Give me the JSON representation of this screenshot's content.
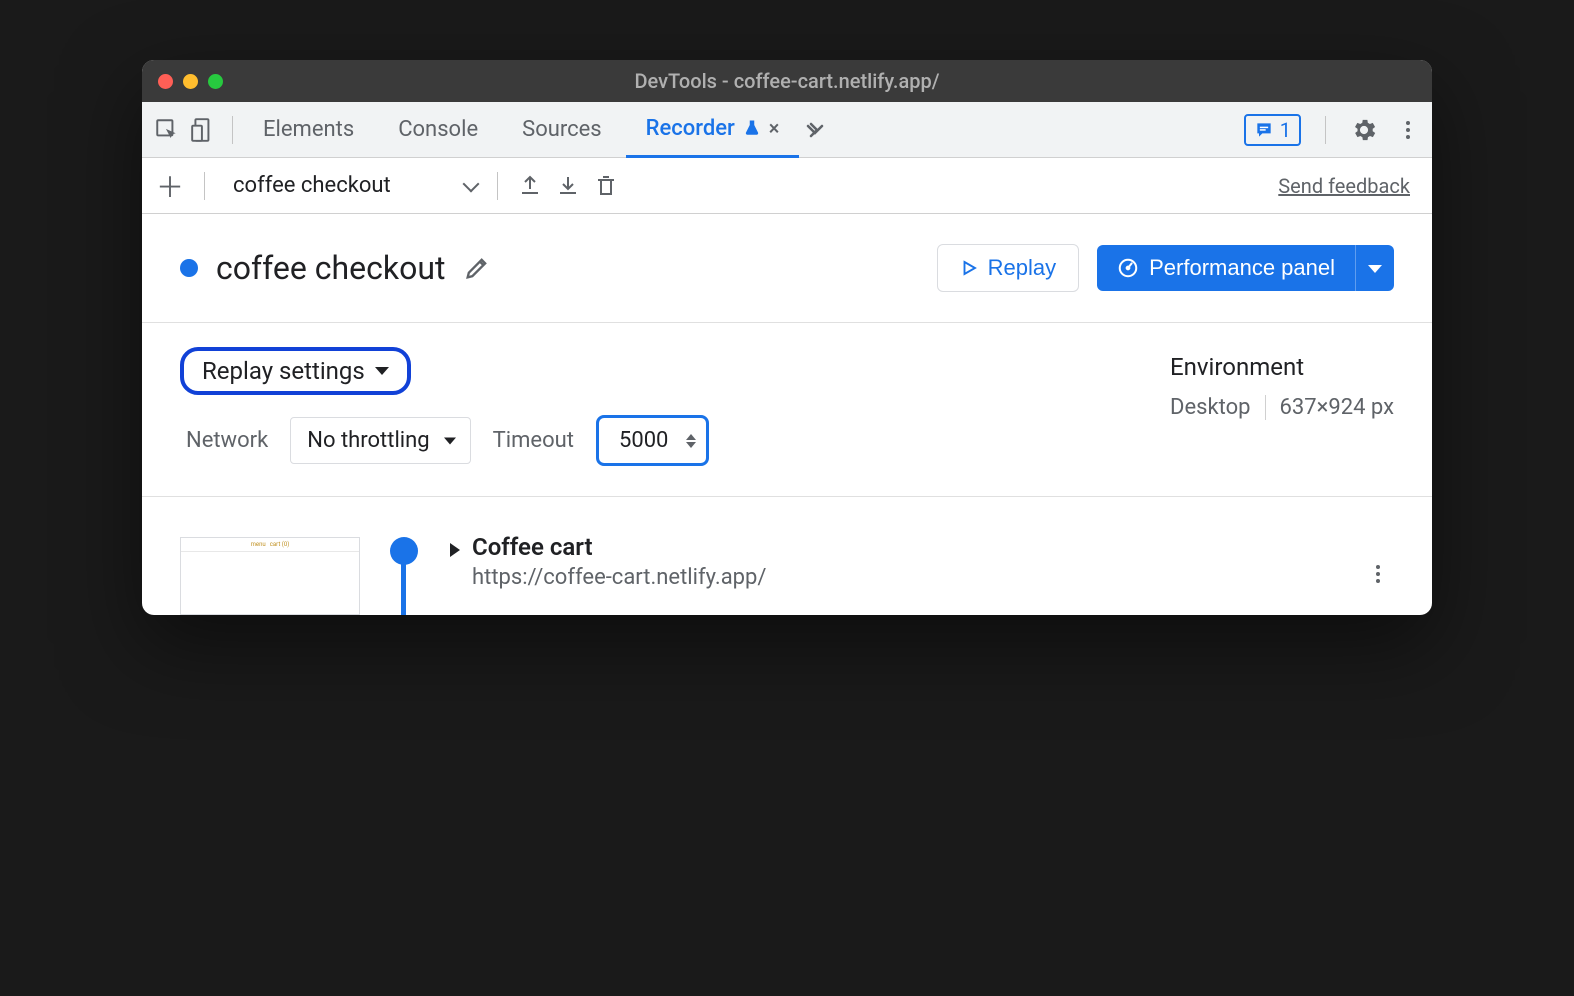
{
  "window": {
    "title": "DevTools - coffee-cart.netlify.app/"
  },
  "tabs": {
    "elements": "Elements",
    "console": "Console",
    "sources": "Sources",
    "recorder": "Recorder"
  },
  "issues_count": "1",
  "toolbar": {
    "recording_name": "coffee checkout",
    "send_feedback": "Send feedback"
  },
  "header": {
    "title": "coffee checkout",
    "replay_label": "Replay",
    "perf_label": "Performance panel"
  },
  "settings": {
    "replay_settings_label": "Replay settings",
    "network_label": "Network",
    "network_value": "No throttling",
    "timeout_label": "Timeout",
    "timeout_value": "5000",
    "environment_label": "Environment",
    "device": "Desktop",
    "dimensions": "637×924 px"
  },
  "step": {
    "title": "Coffee cart",
    "url": "https://coffee-cart.netlify.app/"
  }
}
